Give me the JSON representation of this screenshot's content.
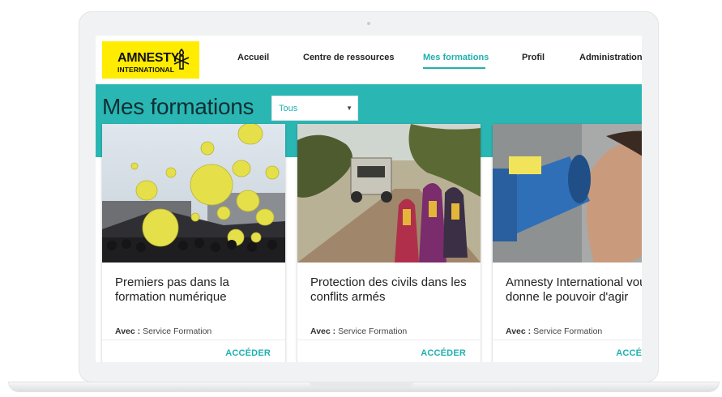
{
  "logo": {
    "line1": "AMNESTY",
    "line2": "INTERNATIONAL"
  },
  "nav": {
    "items": [
      {
        "label": "Accueil",
        "active": false
      },
      {
        "label": "Centre de ressources",
        "active": false
      },
      {
        "label": "Mes formations",
        "active": true
      },
      {
        "label": "Profil",
        "active": false
      },
      {
        "label": "Administration",
        "active": false
      }
    ]
  },
  "header": {
    "title": "Mes formations"
  },
  "filter": {
    "selected": "Tous"
  },
  "cards": [
    {
      "title": "Premiers pas dans la formation numérique",
      "avec_label": "Avec :",
      "avec_value": "Service Formation",
      "action": "ACCÉDER"
    },
    {
      "title": "Protection des civils dans les conflits armés",
      "avec_label": "Avec :",
      "avec_value": "Service Formation",
      "action": "ACCÉDER"
    },
    {
      "title": "Amnesty International vous donne le pouvoir d'agir",
      "avec_label": "Avec :",
      "avec_value": "Service Formation",
      "action": "ACCÉDER"
    }
  ],
  "colors": {
    "accent": "#2ab7b4",
    "brand_yellow": "#ffec00",
    "link": "#1fb0b0"
  }
}
